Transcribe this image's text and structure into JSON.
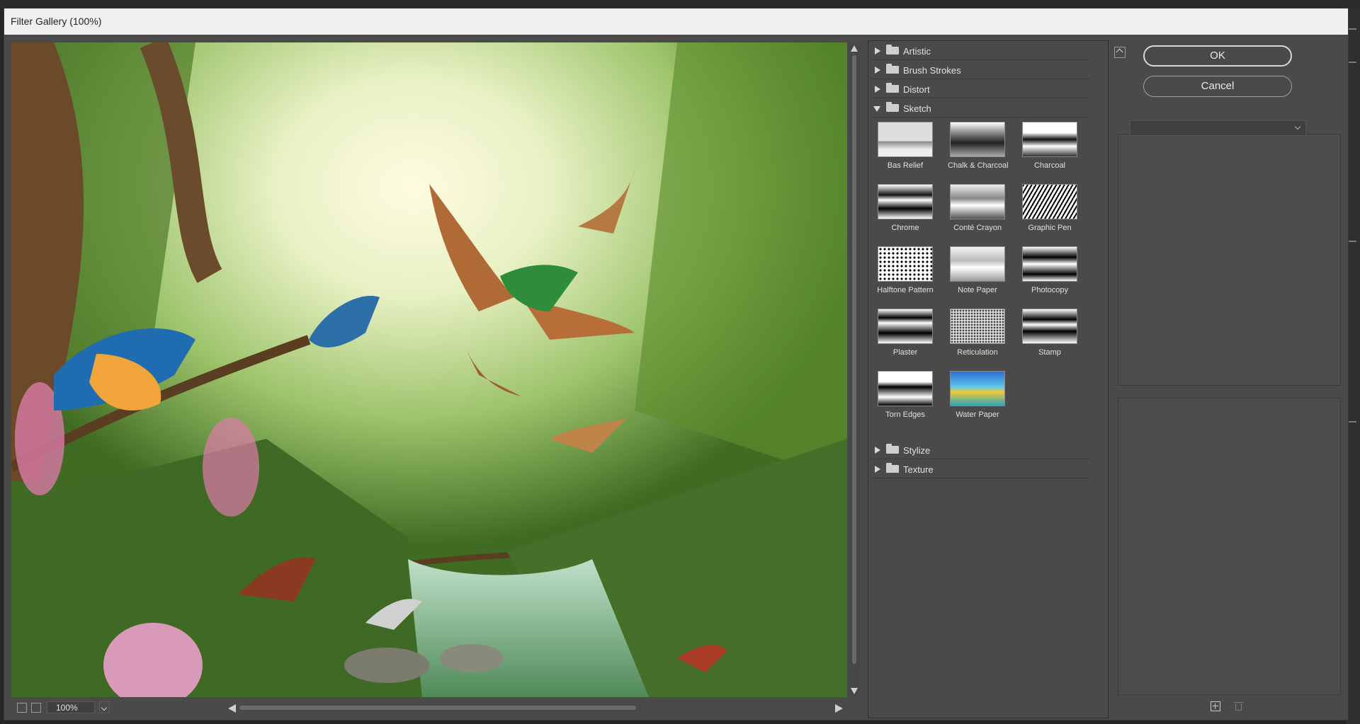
{
  "window": {
    "title": "Filter Gallery (100%)"
  },
  "preview": {
    "image_description_icon": "bird-forest-scene-image",
    "zoom_value": "100%"
  },
  "filter_tree": {
    "categories_top": [
      {
        "label": "Artistic",
        "expanded": false
      },
      {
        "label": "Brush Strokes",
        "expanded": false
      },
      {
        "label": "Distort",
        "expanded": false
      },
      {
        "label": "Sketch",
        "expanded": true
      }
    ],
    "sketch_filters": [
      "Bas Relief",
      "Chalk & Charcoal",
      "Charcoal",
      "Chrome",
      "Conté Crayon",
      "Graphic Pen",
      "Halftone Pattern",
      "Note Paper",
      "Photocopy",
      "Plaster",
      "Reticulation",
      "Stamp",
      "Torn Edges",
      "Water Paper"
    ],
    "categories_bottom": [
      {
        "label": "Stylize",
        "expanded": false
      },
      {
        "label": "Texture",
        "expanded": false
      }
    ]
  },
  "buttons": {
    "ok": "OK",
    "cancel": "Cancel"
  },
  "filter_select": {
    "value": ""
  },
  "icons": {
    "collapse": "collapse-panel-icon",
    "new_layer": "new-effect-layer-icon",
    "delete_layer": "delete-effect-layer-icon"
  }
}
